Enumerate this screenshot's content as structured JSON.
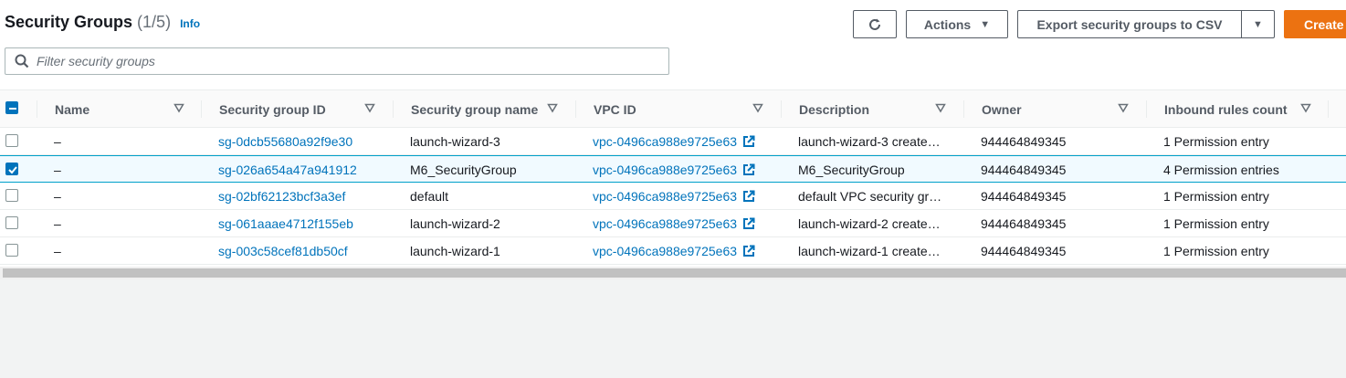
{
  "header": {
    "title": "Security Groups",
    "count": "(1/5)",
    "info": "Info"
  },
  "buttons": {
    "refresh_icon": "refresh-icon",
    "actions": "Actions",
    "export": "Export security groups to CSV",
    "create": "Create"
  },
  "filter": {
    "placeholder": "Filter security groups",
    "value": ""
  },
  "columns": [
    "Name",
    "Security group ID",
    "Security group name",
    "VPC ID",
    "Description",
    "Owner",
    "Inbound rules count"
  ],
  "rows": [
    {
      "checked": false,
      "name": "–",
      "sg_id": "sg-0dcb55680a92f9e30",
      "sg_name": "launch-wizard-3",
      "vpc_id": "vpc-0496ca988e9725e63",
      "description": "launch-wizard-3 create…",
      "owner": "944464849345",
      "inbound": "1 Permission entry"
    },
    {
      "checked": true,
      "name": "–",
      "sg_id": "sg-026a654a47a941912",
      "sg_name": "M6_SecurityGroup",
      "vpc_id": "vpc-0496ca988e9725e63",
      "description": "M6_SecurityGroup",
      "owner": "944464849345",
      "inbound": "4 Permission entries"
    },
    {
      "checked": false,
      "name": "–",
      "sg_id": "sg-02bf62123bcf3a3ef",
      "sg_name": "default",
      "vpc_id": "vpc-0496ca988e9725e63",
      "description": "default VPC security gr…",
      "owner": "944464849345",
      "inbound": "1 Permission entry"
    },
    {
      "checked": false,
      "name": "–",
      "sg_id": "sg-061aaae4712f155eb",
      "sg_name": "launch-wizard-2",
      "vpc_id": "vpc-0496ca988e9725e63",
      "description": "launch-wizard-2 create…",
      "owner": "944464849345",
      "inbound": "1 Permission entry"
    },
    {
      "checked": false,
      "name": "–",
      "sg_id": "sg-003c58cef81db50cf",
      "sg_name": "launch-wizard-1",
      "vpc_id": "vpc-0496ca988e9725e63",
      "description": "launch-wizard-1 create…",
      "owner": "944464849345",
      "inbound": "1 Permission entry"
    }
  ],
  "colors": {
    "link": "#0073bb",
    "primary_button": "#ec7211",
    "selected_row": "#f1faff",
    "selected_border": "#00a1c9"
  }
}
